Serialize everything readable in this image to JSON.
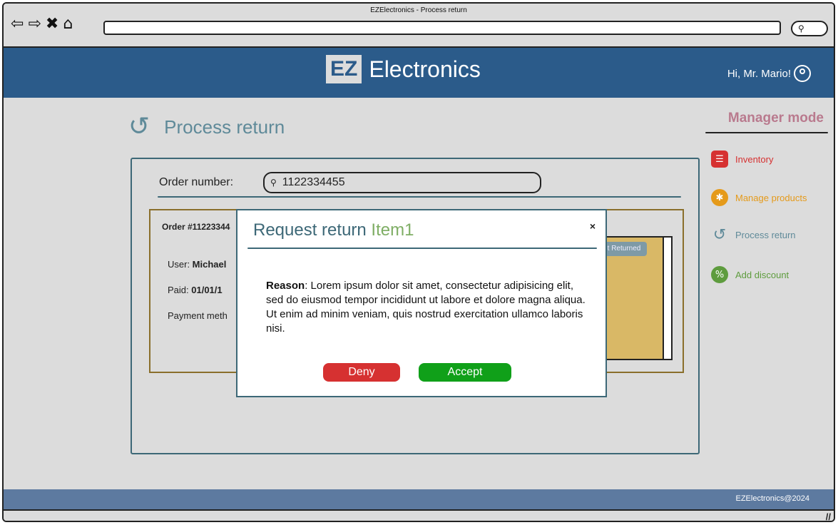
{
  "window": {
    "title": "EZElectronics - Process return"
  },
  "nav": {
    "back": "⇦",
    "forward": "⇨",
    "stop": "✖",
    "home": "⌂"
  },
  "url_search_icon": "search-icon",
  "header": {
    "logo_mark": "EZ",
    "logo_text": "Electronics",
    "greeting": "Hi, Mr. Mario!"
  },
  "page": {
    "title": "Process return",
    "icon": "↺"
  },
  "sidebar": {
    "title": "Manager mode",
    "items": [
      {
        "label": "Inventory",
        "icon": "☰",
        "color": "#d63131"
      },
      {
        "label": "Manage products",
        "icon": "✱",
        "color": "#e59a1a"
      },
      {
        "label": "Process return",
        "icon": "↺",
        "color": "#5f8a99"
      },
      {
        "label": "Add discount",
        "icon": "%",
        "color": "#5e9c3e"
      }
    ]
  },
  "search": {
    "label": "Order number:",
    "value": "1122334455"
  },
  "order": {
    "number": "Order #11223344",
    "user_label": "User: ",
    "user_value": "Michael",
    "paid_label": "Paid: ",
    "paid_value": "01/01/1",
    "payment_label": "Payment meth",
    "returned_badge": "t Returned"
  },
  "modal": {
    "title": "Request return ",
    "title_item": "Item1",
    "close": "×",
    "reason_label": "Reason",
    "reason_text": ": Lorem ipsum dolor sit amet, consectetur adipisicing elit, sed do eiusmod tempor incididunt ut labore et dolore magna aliqua. Ut enim ad minim veniam, quis nostrud exercitation ullamco laboris nisi.",
    "deny_label": "Deny",
    "accept_label": "Accept"
  },
  "footer": {
    "text": "EZElectronics@2024"
  },
  "statusbar": {
    "resize": "//"
  }
}
